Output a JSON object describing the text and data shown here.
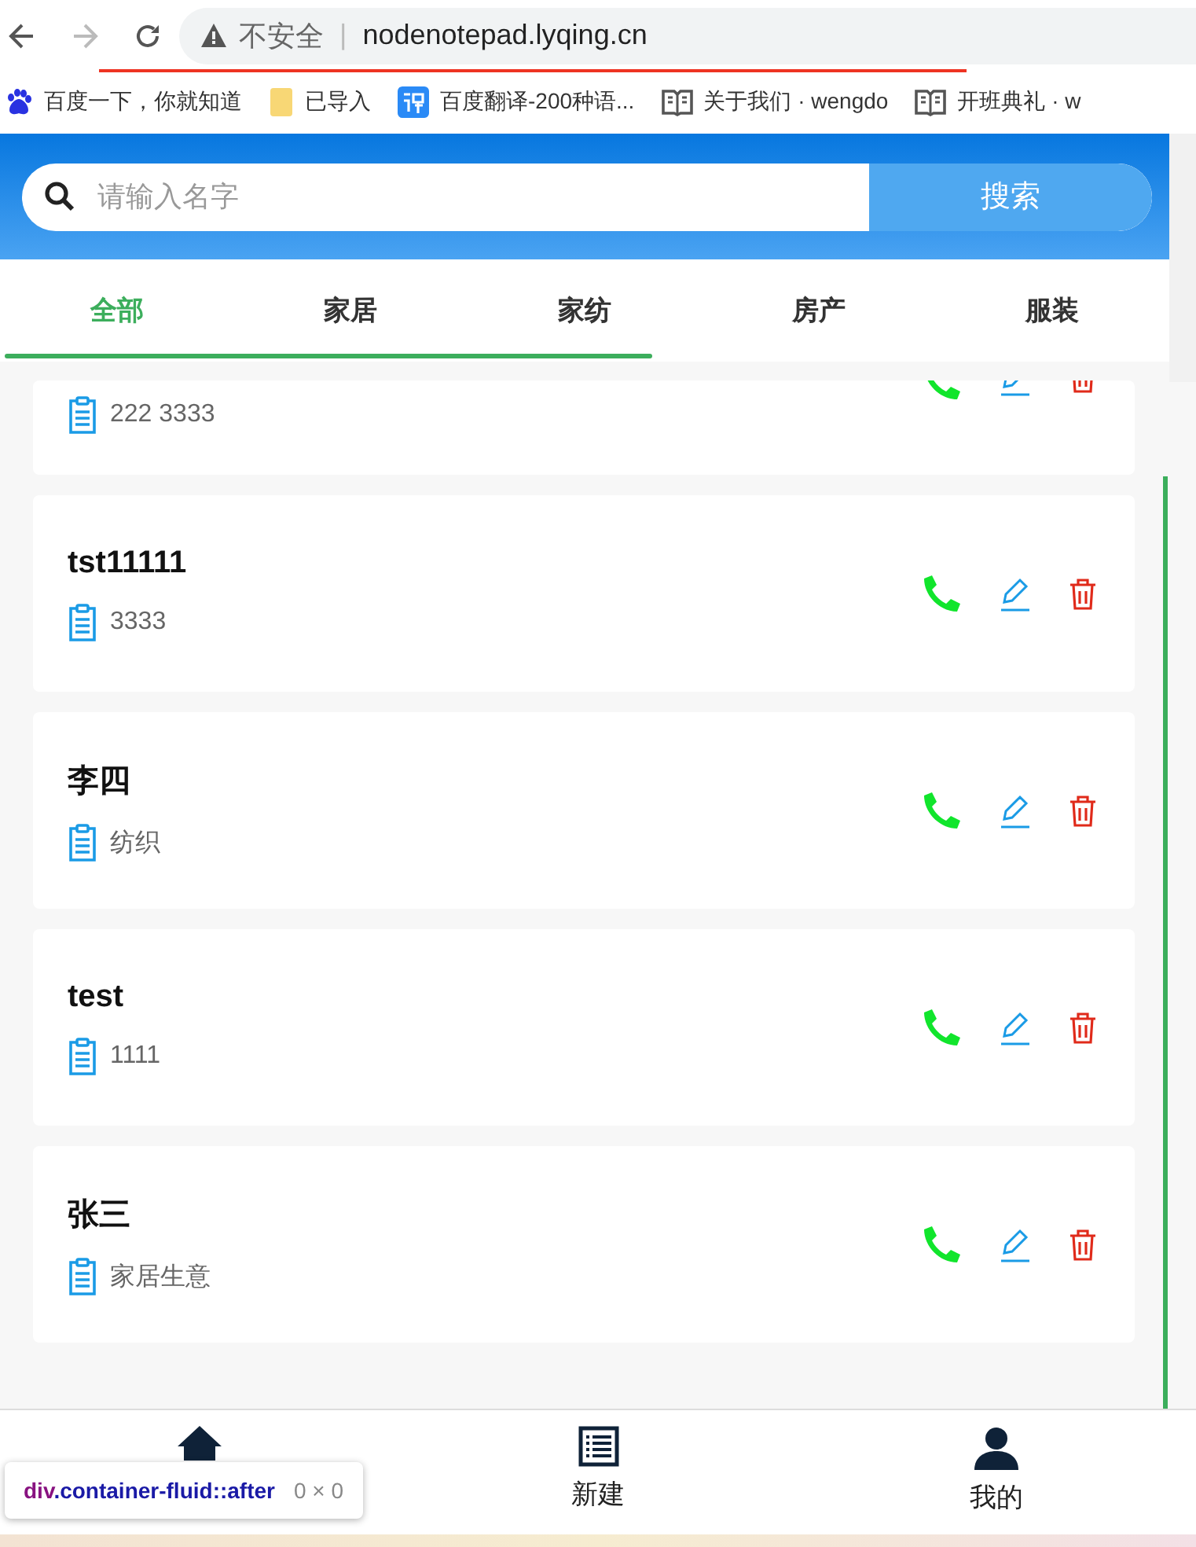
{
  "browser": {
    "back_disabled": false,
    "forward_disabled": true,
    "security": "不安全",
    "separator": "|",
    "url": "nodenotepad.lyqing.cn"
  },
  "bookmarks": [
    {
      "kind": "paw",
      "label": "百度一下，你就知道"
    },
    {
      "kind": "folder",
      "label": "已导入"
    },
    {
      "kind": "translate",
      "label": "百度翻译-200种语..."
    },
    {
      "kind": "book",
      "label": "关于我们 · wengdo"
    },
    {
      "kind": "book",
      "label": "开班典礼 · w"
    }
  ],
  "search": {
    "placeholder": "请输入名字",
    "button": "搜索"
  },
  "tabs": [
    {
      "label": "全部",
      "selected": true
    },
    {
      "label": "家居",
      "selected": false
    },
    {
      "label": "家纺",
      "selected": false
    },
    {
      "label": "房产",
      "selected": false
    },
    {
      "label": "服装",
      "selected": false
    }
  ],
  "contacts": [
    {
      "note": "222 3333"
    },
    {
      "name": "tst11111",
      "note": "3333"
    },
    {
      "name": "李四",
      "note": "纺织"
    },
    {
      "name": "test",
      "note": "1111"
    },
    {
      "name": "张三",
      "note": "家居生意"
    }
  ],
  "bottom_nav": [
    {
      "kind": "home"
    },
    {
      "kind": "list",
      "label": "新建"
    },
    {
      "kind": "user",
      "label": "我的"
    }
  ],
  "devtools_tooltip": {
    "selector_tag": "div",
    "selector_rest": ".container-fluid::after",
    "size": "0 × 0"
  }
}
